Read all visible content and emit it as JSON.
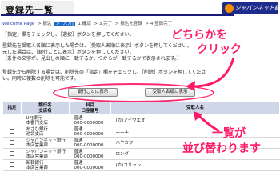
{
  "header": {
    "title": "登録先一覧",
    "logo_text": "ジャパンネット銀行"
  },
  "breadcrumb": {
    "home": "Welcome Page",
    "items": [
      "> 振込",
      "> [入力]",
      "1.確認",
      "> 3.完了",
      "> 振込先登録",
      "> 4.登録完了"
    ]
  },
  "instructions": {
    "line1": "「指定」欄をチェックし、［選択］ボタンを押してください。",
    "line2": "登録先を受取人名順に表示した場合は、［受取人名順に表示］ボタンを押してください。",
    "line3": "元した場合は、［銀行ごとに表示］ボタンを押してください。",
    "line4": "（条件の文字が、見出しの順に一致するか、つからが一致するかで表示されます。）",
    "line5": "登録先から削除する場合は、削除先の「指定」欄をチェックし、［削除］ボタンを押してくださ",
    "line6": "い。同時に複数の削除も可能です。"
  },
  "buttons": {
    "by_bank": "銀行ごとに表示",
    "by_name": "受取人名順に表示"
  },
  "table": {
    "headers": {
      "select": "指定",
      "bank": "銀行名\n支店名",
      "account": "科目\n口座番号",
      "recipient": "受取人名"
    },
    "rows": [
      {
        "bank": "UFJ銀行",
        "branch": "本番円支店",
        "type": "普通",
        "number": "000-0000000",
        "name": "(カ)アイウエオ"
      },
      {
        "bank": "あさひ銀行",
        "branch": "池袋支店",
        "type": "普通",
        "number": "000-0000000",
        "name": "エエエ"
      },
      {
        "bank": "ジャパンネット銀行",
        "branch": "本店営業部",
        "type": "普通",
        "number": "000-0000000",
        "name": "ハヤカワ"
      },
      {
        "bank": "ジャパンネット銀行",
        "branch": "本店営業部",
        "type": "普通",
        "number": "000-0000000",
        "name": "ロンダ"
      },
      {
        "bank": "新韓銀行",
        "branch": "本店営業部",
        "type": "普通",
        "number": "000-0000000",
        "name": "(カ)コリャン"
      }
    ]
  },
  "annotations": {
    "click_line1": "どちらかを",
    "click_line2": "クリック",
    "sort_line1": "一覧が",
    "sort_line2": "並び替わります"
  },
  "colors": {
    "accent": "#ff1a66",
    "header_blue": "#1a1a7a",
    "table_header": "#cfd6e8"
  }
}
